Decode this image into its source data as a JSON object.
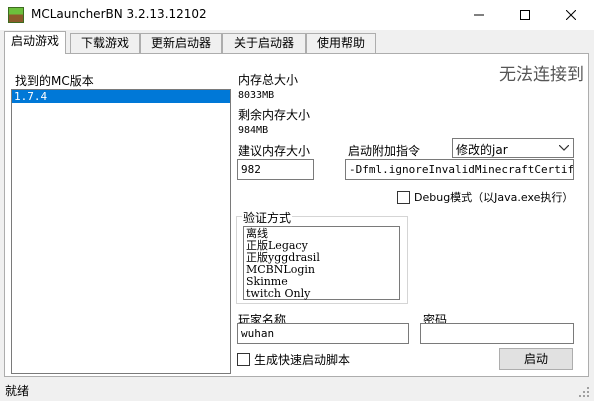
{
  "window": {
    "title": "MCLauncherBN 3.2.13.12102"
  },
  "tabs": [
    {
      "label": "启动游戏"
    },
    {
      "label": "下载游戏"
    },
    {
      "label": "更新启动器"
    },
    {
      "label": "关于启动器"
    },
    {
      "label": "使用帮助"
    }
  ],
  "versions": {
    "label": "找到的MC版本",
    "items": [
      "1.7.4"
    ]
  },
  "memory": {
    "total_label": "内存总大小",
    "total_value": "8033MB",
    "free_label": "剩余内存大小",
    "free_value": "984MB",
    "suggest_label": "建议内存大小",
    "suggest_value": "982"
  },
  "connection_notice": "无法连接到",
  "launch_args": {
    "label": "启动附加指令",
    "select_value": "修改的jar",
    "args_value": "-Dfml.ignoreInvalidMinecraftCertificates=true"
  },
  "debug": {
    "label": "Debug模式（以Java.exe执行）",
    "checked": false
  },
  "auth": {
    "label": "验证方式",
    "items": [
      "离线",
      "正版Legacy",
      "正版yggdrasil",
      "MCBNLogin",
      "Skinme",
      "twitch Only"
    ]
  },
  "player": {
    "label": "玩家名称",
    "value": "wuhan"
  },
  "password": {
    "label": "密码",
    "value": ""
  },
  "script_option": {
    "label": "生成快速启动脚本",
    "checked": false
  },
  "launch_button": {
    "label": "启动"
  },
  "status": {
    "text": "就绪"
  }
}
